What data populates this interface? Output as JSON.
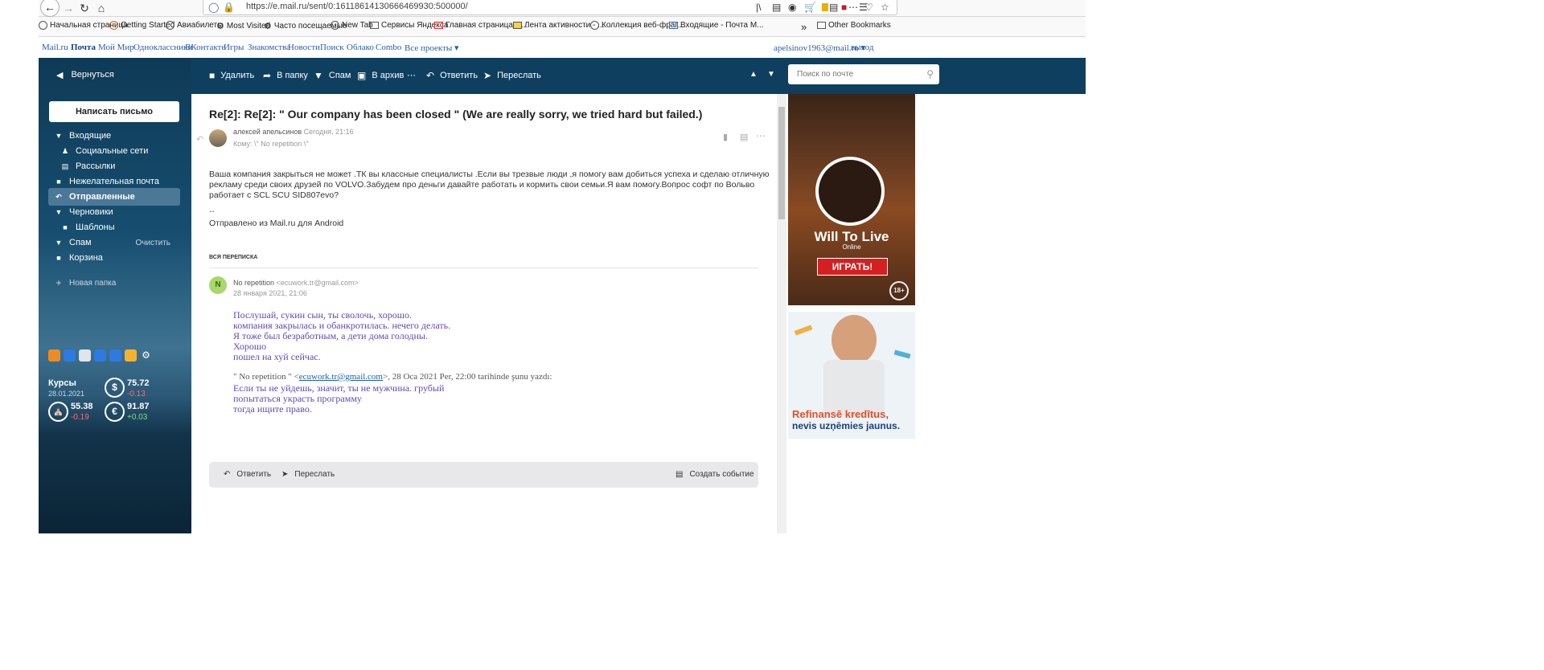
{
  "browser": {
    "url": "https://e.mail.ru/sent/0:16118614130666469930:500000/",
    "bookmarks": [
      "Начальная страница",
      "Getting Started",
      "Авиабилеты",
      "Most Visited",
      "Часто посещаемые",
      "New Tab",
      "Сервисы Яндекса",
      "Главная страница Я...",
      "Лента активности - ...",
      "Коллекция веб-фраг...",
      "Входящие - Почта М..."
    ],
    "other_bookmarks": "Other Bookmarks"
  },
  "portal": {
    "links": [
      "Mail.ru",
      "Почта",
      "Мой Мир",
      "Одноклассники",
      "ВКонтакте",
      "Игры",
      "Знакомства",
      "Новости",
      "Поиск",
      "Облако",
      "Combo",
      "Все проекты"
    ],
    "user": "apelsinov1963@mail.ru",
    "logout": "выход"
  },
  "toolbar": {
    "back": "Вернуться",
    "delete": "Удалить",
    "to_folder": "В папку",
    "spam": "Спам",
    "archive": "В архив",
    "reply": "Ответить",
    "forward": "Переслать",
    "search_placeholder": "Поиск по почте"
  },
  "sidebar": {
    "compose": "Написать письмо",
    "folders": [
      {
        "label": "Входящие",
        "icon": "triangle-down-icon"
      },
      {
        "label": "Социальные сети",
        "icon": "people-icon"
      },
      {
        "label": "Рассылки",
        "icon": "newsletter-icon"
      },
      {
        "label": "Нежелательная почта",
        "icon": "lock-icon"
      },
      {
        "label": "Отправленные",
        "icon": "sent-icon"
      },
      {
        "label": "Черновики",
        "icon": "triangle-down-icon"
      },
      {
        "label": "Шаблоны",
        "icon": "folder-icon"
      },
      {
        "label": "Спам",
        "icon": "thumb-down-icon"
      },
      {
        "label": "Корзина",
        "icon": "trash-icon"
      }
    ],
    "clean": "Очистить",
    "new_folder": "Новая папка",
    "rates": {
      "title": "Курсы",
      "date": "28.01.2021",
      "usd_value": "75.72",
      "usd_change": "-0.13",
      "oil_value": "55.38",
      "oil_change": "-0.19",
      "eur_value": "91.87",
      "eur_change": "+0.03"
    }
  },
  "message": {
    "subject": "Re[2]: Re[2]: \" Our company has been closed \" (We are really sorry, we tried hard but failed.)",
    "from": "алексей апельсинов",
    "time": "Сегодня, 21:16",
    "to": "Кому: \\\" No repetition \\\"",
    "body": [
      "Ваша компания закрыться не может .ТК вы классные специалисты .Если вы трезвые люди ,я помогу вам добиться успеха и сделаю отличную",
      "рекламу среди своих друзей по VOLVO.Забудем про деньги  давайте работать и кормить свои семьи.Я вам помогу.Вопрос софт по Вольво",
      "работает  с SCL SCU SID807evo?"
    ],
    "sig_sep": "--",
    "signature": "Отправлено из Mail.ru для Android",
    "thread_label": "ВСЯ ПЕРЕПИСКА",
    "quoted": {
      "avatar_letter": "N",
      "from": "No repetition",
      "email": "<ecuwork.tr@gmail.com>",
      "date": "28 января 2021, 21:06",
      "lines": [
        "Послушай, сукин сын, ты сволочь, хорошо.",
        "компания закрылась и обанкротилась. нечего делать.",
        "Я тоже был безработным, а дети дома голодны.",
        "Хорошо",
        "пошел на хуй сейчас."
      ],
      "quote_header_a": "\" No repetition \" <",
      "quote_link": "ecuwork.tr@gmail.com",
      "quote_header_b": ">, 28 Oca 2021 Per, 22:00 tarihinde şunu yazdı:",
      "lines2": [
        "Если ты не уйдешь, значит, ты не мужчина. грубый",
        "попытаться украсть программу",
        "тогда ищите право."
      ]
    }
  },
  "replybar": {
    "reply": "Ответить",
    "forward": "Переслать",
    "event": "Создать событие"
  },
  "ads": {
    "game_title": "Will To Live",
    "game_sub": "Online",
    "play": "ИГРАТЬ!",
    "age": "18+",
    "banner_line1": "Refinansē kredītus,",
    "banner_line2": "nevis uzņēmies jaunus."
  }
}
